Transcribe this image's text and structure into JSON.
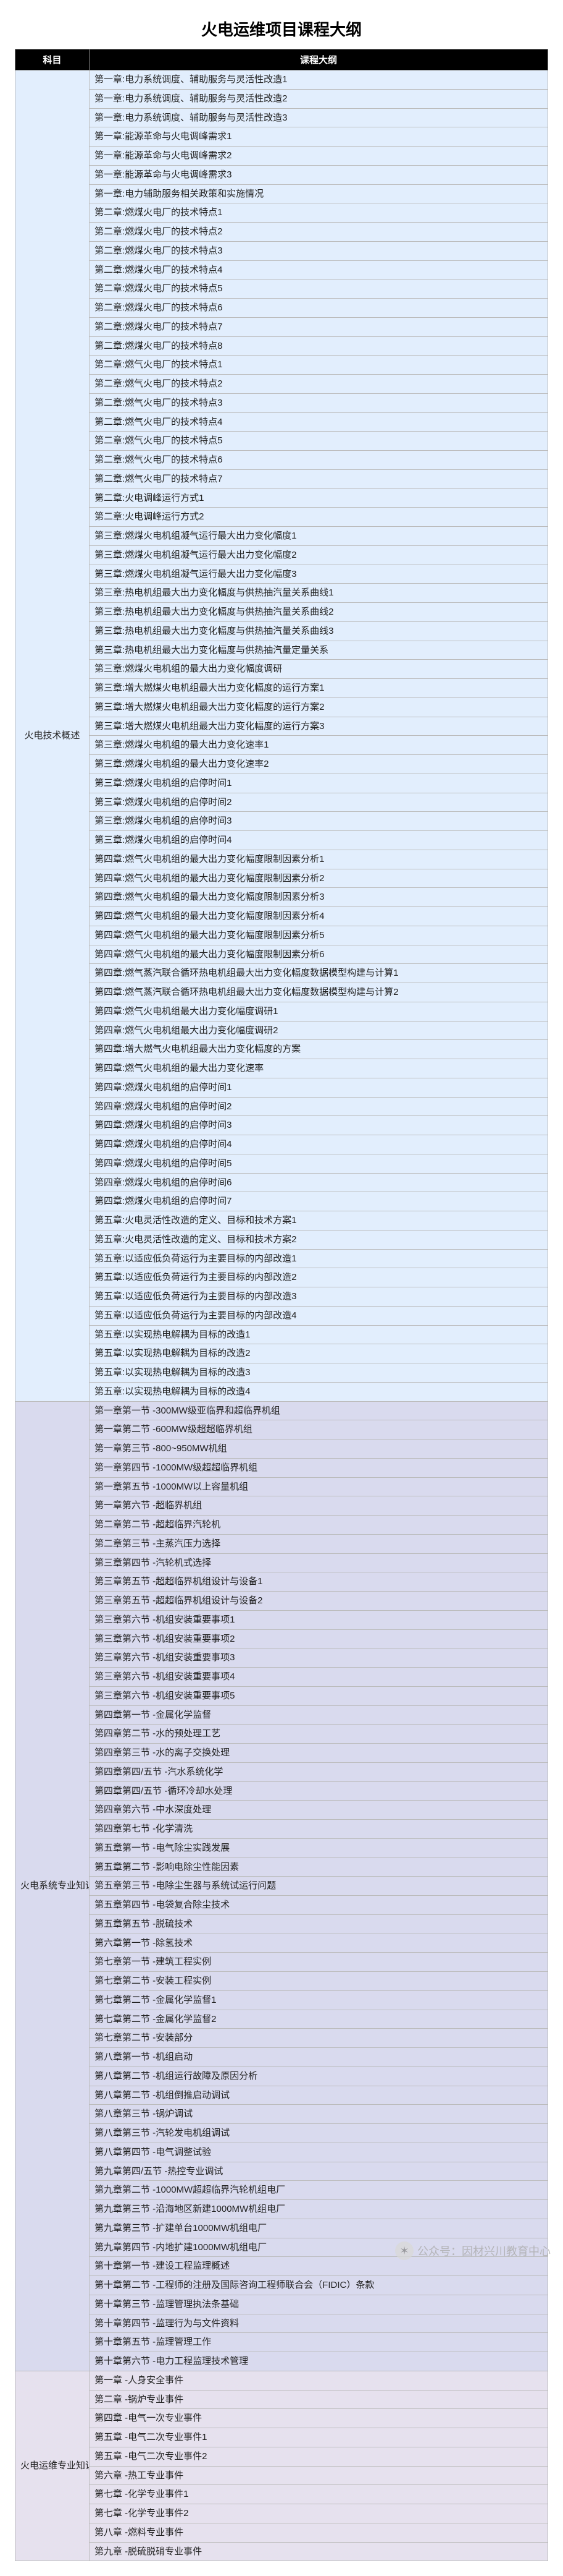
{
  "title": "火电运维项目课程大纲",
  "columns": [
    "科目",
    "课程大纲"
  ],
  "watermark": {
    "label": "公众号：因材兴川教育中心"
  },
  "sections": [
    {
      "subject": "火电技术概述",
      "rows": [
        "第一章:电力系统调度、辅助服务与灵活性改造1",
        "第一章:电力系统调度、辅助服务与灵活性改造2",
        "第一章:电力系统调度、辅助服务与灵活性改造3",
        "第一章:能源革命与火电调峰需求1",
        "第一章:能源革命与火电调峰需求2",
        "第一章:能源革命与火电调峰需求3",
        "第一章:电力辅助服务相关政策和实施情况",
        "第二章:燃煤火电厂的技术特点1",
        "第二章:燃煤火电厂的技术特点2",
        "第二章:燃煤火电厂的技术特点3",
        "第二章:燃煤火电厂的技术特点4",
        "第二章:燃煤火电厂的技术特点5",
        "第二章:燃煤火电厂的技术特点6",
        "第二章:燃煤火电厂的技术特点7",
        "第二章:燃煤火电厂的技术特点8",
        "第二章:燃气火电厂的技术特点1",
        "第二章:燃气火电厂的技术特点2",
        "第二章:燃气火电厂的技术特点3",
        "第二章:燃气火电厂的技术特点4",
        "第二章:燃气火电厂的技术特点5",
        "第二章:燃气火电厂的技术特点6",
        "第二章:燃气火电厂的技术特点7",
        "第二章:火电调峰运行方式1",
        "第二章:火电调峰运行方式2",
        "第三章:燃煤火电机组凝气运行最大出力变化幅度1",
        "第三章:燃煤火电机组凝气运行最大出力变化幅度2",
        "第三章:燃煤火电机组凝气运行最大出力变化幅度3",
        "第三章:热电机组最大出力变化幅度与供热抽汽量关系曲线1",
        "第三章:热电机组最大出力变化幅度与供热抽汽量关系曲线2",
        "第三章:热电机组最大出力变化幅度与供热抽汽量关系曲线3",
        "第三章:热电机组最大出力变化幅度与供热抽汽量定量关系",
        "第三章:燃煤火电机组的最大出力变化幅度调研",
        "第三章:增大燃煤火电机组最大出力变化幅度的运行方案1",
        "第三章:增大燃煤火电机组最大出力变化幅度的运行方案2",
        "第三章:增大燃煤火电机组最大出力变化幅度的运行方案3",
        "第三章:燃煤火电机组的最大出力变化速率1",
        "第三章:燃煤火电机组的最大出力变化速率2",
        "第三章:燃煤火电机组的启停时间1",
        "第三章:燃煤火电机组的启停时间2",
        "第三章:燃煤火电机组的启停时间3",
        "第三章:燃煤火电机组的启停时间4",
        "第四章:燃气火电机组的最大出力变化幅度限制因素分析1",
        "第四章:燃气火电机组的最大出力变化幅度限制因素分析2",
        "第四章:燃气火电机组的最大出力变化幅度限制因素分析3",
        "第四章:燃气火电机组的最大出力变化幅度限制因素分析4",
        "第四章:燃气火电机组的最大出力变化幅度限制因素分析5",
        "第四章:燃气火电机组的最大出力变化幅度限制因素分析6",
        "第四章:燃气蒸汽联合循环热电机组最大出力变化幅度数据模型构建与计算1",
        "第四章:燃气蒸汽联合循环热电机组最大出力变化幅度数据模型构建与计算2",
        "第四章:燃气火电机组最大出力变化幅度调研1",
        "第四章:燃气火电机组最大出力变化幅度调研2",
        "第四章:增大燃气火电机组最大出力变化幅度的方案",
        "第四章:燃气火电机组的最大出力变化速率",
        "第四章:燃煤火电机组的启停时间1",
        "第四章:燃煤火电机组的启停时间2",
        "第四章:燃煤火电机组的启停时间3",
        "第四章:燃煤火电机组的启停时间4",
        "第四章:燃煤火电机组的启停时间5",
        "第四章:燃煤火电机组的启停时间6",
        "第四章:燃煤火电机组的启停时间7",
        "第五章:火电灵活性改造的定义、目标和技术方案1",
        "第五章:火电灵活性改造的定义、目标和技术方案2",
        "第五章:以适应低负荷运行为主要目标的内部改造1",
        "第五章:以适应低负荷运行为主要目标的内部改造2",
        "第五章:以适应低负荷运行为主要目标的内部改造3",
        "第五章:以适应低负荷运行为主要目标的内部改造4",
        "第五章:以实现热电解耦为目标的改造1",
        "第五章:以实现热电解耦为目标的改造2",
        "第五章:以实现热电解耦为目标的改造3",
        "第五章:以实现热电解耦为目标的改造4"
      ]
    },
    {
      "subject": "火电系统专业知识",
      "rows": [
        "第一章第一节 -300MW级亚临界和超临界机组",
        "第一章第二节 -600MW级超超临界机组",
        "第一章第三节 -800~950MW机组",
        "第一章第四节 -1000MW级超超临界机组",
        "第一章第五节 -1000MW以上容量机组",
        "第一章第六节 -超临界机组",
        "第二章第二节 -超超临界汽轮机",
        "第二章第三节 -主蒸汽压力选择",
        "第三章第四节 -汽轮机式选择",
        "第三章第五节 -超超临界机组设计与设备1",
        "第三章第五节 -超超临界机组设计与设备2",
        "第三章第六节 -机组安装重要事项1",
        "第三章第六节 -机组安装重要事项2",
        "第三章第六节 -机组安装重要事项3",
        "第三章第六节 -机组安装重要事项4",
        "第三章第六节 -机组安装重要事项5",
        "第四章第一节 -金属化学监督",
        "第四章第二节 -水的预处理工艺",
        "第四章第三节 -水的离子交换处理",
        "第四章第四/五节 -汽水系统化学",
        "第四章第四/五节 -循环冷却水处理",
        "第四章第六节 -中水深度处理",
        "第四章第七节 -化学清洗",
        "第五章第一节 -电气除尘实践发展",
        "第五章第二节 -影响电除尘性能因素",
        "第五章第三节 -电除尘生器与系统试运行问题",
        "第五章第四节 -电袋复合除尘技术",
        "第五章第五节 -脱硫技术",
        "第六章第一节 -除氢技术",
        "第七章第一节 -建筑工程实例",
        "第七章第二节 -安装工程实例",
        "第七章第二节 -金属化学监督1",
        "第七章第二节 -金属化学监督2",
        "第七章第二节 -安装部分",
        "第八章第一节 -机组启动",
        "第八章第二节 -机组运行故障及原因分析",
        "第八章第二节 -机组倒推启动调试",
        "第八章第三节 -锅炉调试",
        "第八章第三节 -汽轮发电机组调试",
        "第八章第四节 -电气调整试验",
        "第九章第四/五节 -热控专业调试",
        "第九章第二节 -1000MW超超临界汽轮机组电厂",
        "第九章第三节 -沿海地区新建1000MW机组电厂",
        "第九章第三节 -扩建单台1000MW机组电厂",
        "第九章第四节 -内地扩建1000MW机组电厂",
        "第十章第一节 -建设工程监理概述",
        "第十章第二节 -工程师的注册及国际咨询工程师联合会（FIDIC）条款",
        "第十章第三节 -监理管理执法条基础",
        "第十章第四节 -监理行为与文件资料",
        "第十章第五节 -监理管理工作",
        "第十章第六节 -电力工程监理技术管理"
      ]
    },
    {
      "subject": "火电运维专业知识",
      "rows": [
        "第一章 -人身安全事件",
        "第二章 -锅炉专业事件",
        "第四章 -电气一次专业事件",
        "第五章 -电气二次专业事件1",
        "第五章 -电气二次专业事件2",
        "第六章 -热工专业事件",
        "第七章 -化学专业事件1",
        "第七章 -化学专业事件2",
        "第八章 -燃料专业事件",
        "第九章 -脱硫脱硝专业事件"
      ]
    }
  ]
}
